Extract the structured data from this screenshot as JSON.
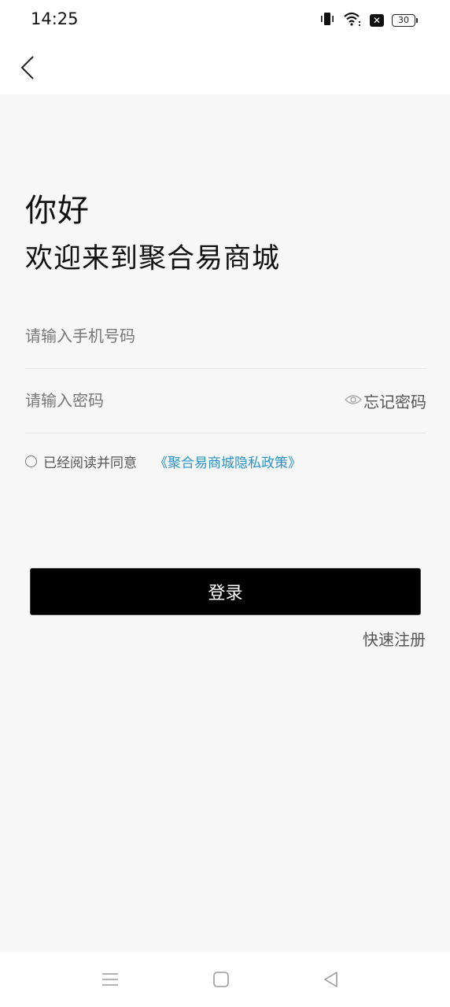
{
  "status_bar": {
    "time": "14:25",
    "battery": "30",
    "icons": [
      "vibrate-icon",
      "wifi-icon",
      "notification-x-icon",
      "battery-icon"
    ]
  },
  "nav": {
    "back_icon": "chevron-left-icon"
  },
  "header": {
    "greeting": "你好",
    "welcome": "欢迎来到聚合易商城"
  },
  "form": {
    "phone_placeholder": "请输入手机号码",
    "phone_value": "",
    "password_placeholder": "请输入密码",
    "password_value": "",
    "forgot_label": "忘记密码",
    "agree_text": "已经阅读并同意",
    "policy_link": "《聚合易商城隐私政策》",
    "agree_checked": false
  },
  "actions": {
    "login_label": "登录",
    "register_label": "快速注册"
  },
  "system_nav": [
    "menu-icon",
    "home-icon",
    "back-triangle-icon"
  ],
  "colors": {
    "accent_link": "#2a93c6",
    "primary_button": "#000000",
    "background": "#f7f7f7"
  }
}
